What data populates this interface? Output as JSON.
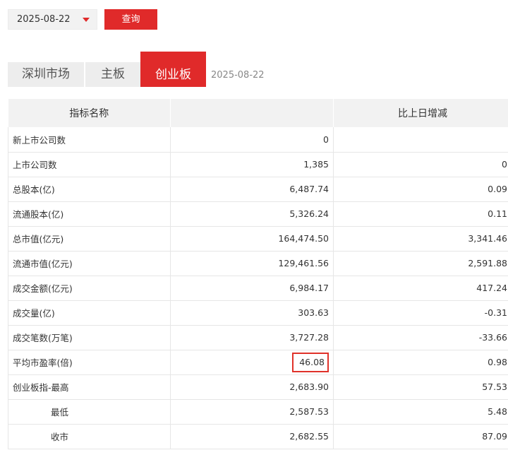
{
  "controls": {
    "date_value": "2025-08-22",
    "query_label": "查询"
  },
  "tabs": [
    {
      "label": "深圳市场",
      "active": false
    },
    {
      "label": "主板",
      "active": false
    },
    {
      "label": "创业板",
      "active": true
    }
  ],
  "tab_date": "2025-08-22",
  "table": {
    "headers": [
      "指标名称",
      "",
      "比上日增减"
    ],
    "rows": [
      {
        "name": "新上市公司数",
        "value": "0",
        "change": ""
      },
      {
        "name": "上市公司数",
        "value": "1,385",
        "change": "0"
      },
      {
        "name": "总股本(亿)",
        "value": "6,487.74",
        "change": "0.09"
      },
      {
        "name": "流通股本(亿)",
        "value": "5,326.24",
        "change": "0.11"
      },
      {
        "name": "总市值(亿元)",
        "value": "164,474.50",
        "change": "3,341.46"
      },
      {
        "name": "流通市值(亿元)",
        "value": "129,461.56",
        "change": "2,591.88"
      },
      {
        "name": "成交金额(亿元)",
        "value": "6,984.17",
        "change": "417.24"
      },
      {
        "name": "成交量(亿)",
        "value": "303.63",
        "change": "-0.31"
      },
      {
        "name": "成交笔数(万笔)",
        "value": "3,727.28",
        "change": "-33.66"
      },
      {
        "name": "平均市盈率(倍)",
        "value": "46.08",
        "change": "0.98"
      },
      {
        "name": "创业板指-最高",
        "value": "2,683.90",
        "change": "57.53"
      },
      {
        "name": "最低",
        "value": "2,587.53",
        "change": "5.48"
      },
      {
        "name": "收市",
        "value": "2,682.55",
        "change": "87.09"
      }
    ]
  },
  "colors": {
    "accent": "#e02a2a"
  }
}
